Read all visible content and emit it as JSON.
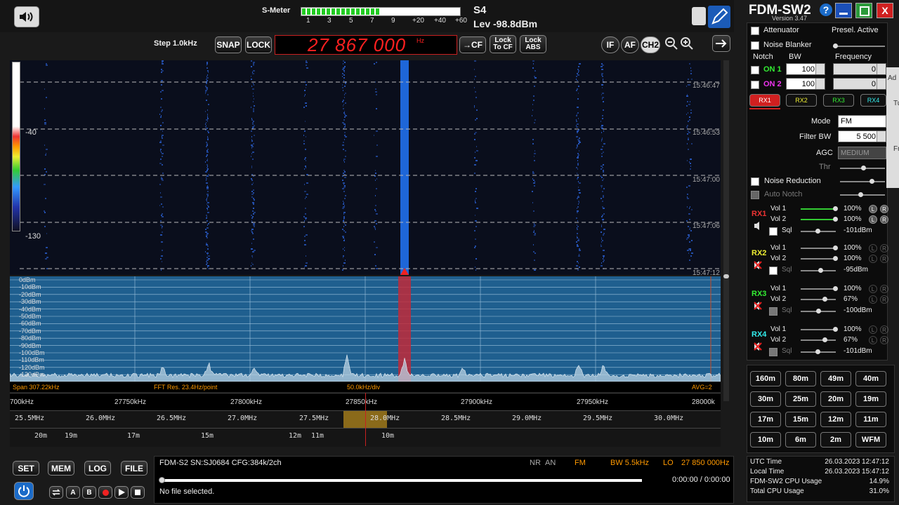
{
  "app": {
    "title": "FDM-SW2",
    "version": "Version 3.47"
  },
  "smeter": {
    "label": "S-Meter",
    "scale": [
      "1",
      "3",
      "5",
      "7",
      "9",
      "+20",
      "+40",
      "+60"
    ],
    "s_value": "S4",
    "level": "Lev -98.8dBm",
    "fill_fraction": 0.5
  },
  "toolbar": {
    "step": "Step 1.0kHz",
    "snap": "SNAP",
    "lock": "LOCK",
    "frequency": "27 867 000",
    "freq_unit": "Hz",
    "cf": "→CF",
    "lock_to_cf": "Lock To CF",
    "lock_abs": "Lock ABS",
    "if": "IF",
    "af": "AF",
    "ch2": "CH2"
  },
  "waterfall": {
    "scale_top": "-40",
    "scale_bottom": "-130",
    "timestamps": [
      "15:46:47",
      "15:46:53",
      "15:47:00",
      "15:47:06",
      "15:47:12"
    ]
  },
  "spectrum": {
    "db_labels": [
      "0dBm",
      "-10dBm",
      "-20dBm",
      "-30dBm",
      "-40dBm",
      "-50dBm",
      "-60dBm",
      "-70dBm",
      "-80dBm",
      "-90dBm",
      "-100dBm",
      "-110dBm",
      "-120dBm",
      "-130dBm"
    ],
    "span": "Span 307.22kHz",
    "fft_res": "FFT Res. 23.4Hz/point",
    "div": "50.0kHz/div",
    "avg": "AVG=2"
  },
  "freq_axis": [
    "700kHz",
    "27750kHz",
    "27800kHz",
    "27850kHz",
    "27900kHz",
    "27950kHz",
    "28000k"
  ],
  "band_axis": [
    "25.5MHz",
    "26.0MHz",
    "26.5MHz",
    "27.0MHz",
    "27.5MHz",
    "28.0MHz",
    "28.5MHz",
    "29.0MHz",
    "29.5MHz",
    "30.0MHz"
  ],
  "meter_axis": [
    "20m",
    "19m",
    "17m",
    "15m",
    "12m",
    "11m",
    "10m"
  ],
  "bottom_buttons": {
    "set": "SET",
    "mem": "MEM",
    "log": "LOG",
    "file": "FILE",
    "a": "A",
    "b": "B"
  },
  "status": {
    "device": "FDM-S2 SN:SJ0684  CFG:384k/2ch",
    "nr": "NR",
    "an": "AN",
    "mode": "FM",
    "bw": "BW 5.5kHz",
    "lo": "LO",
    "lo_freq": "27 850 000Hz",
    "time": "0:00:00 / 0:00:00",
    "file": "No file selected."
  },
  "right_panel": {
    "attenuator": "Attenuator",
    "presel": "Presel. Active",
    "noise_blanker": "Noise Blanker",
    "notch": "Notch",
    "bw": "BW",
    "frequency": "Frequency",
    "on1": "ON 1",
    "on2": "ON 2",
    "bw1": "100",
    "bw2": "100",
    "f1": "0",
    "f2": "0",
    "rx_tabs": [
      "RX1",
      "RX2",
      "RX3",
      "RX4"
    ],
    "mode_label": "Mode",
    "mode": "FM",
    "filter_bw_label": "Filter BW",
    "filter_bw": "5 500",
    "agc_label": "AGC",
    "agc": "MEDIUM",
    "thr": "Thr",
    "noise_reduction": "Noise Reduction",
    "auto_notch": "Auto Notch",
    "vol1": "Vol 1",
    "vol2": "Vol 2",
    "sql": "Sql",
    "l": "L",
    "r": "R",
    "receivers": [
      {
        "name": "RX1",
        "color": "#e33",
        "vol1": "100%",
        "vol2": "100%",
        "sql": "-101dBm",
        "v1f": 1.0,
        "v2f": 1.0,
        "sf": 0.45
      },
      {
        "name": "RX2",
        "color": "#ee3",
        "vol1": "100%",
        "vol2": "100%",
        "sql": "-95dBm",
        "v1f": 1.0,
        "v2f": 1.0,
        "sf": 0.55
      },
      {
        "name": "RX3",
        "color": "#3e3",
        "vol1": "100%",
        "vol2": "67%",
        "sql": "-100dBm",
        "v1f": 1.0,
        "v2f": 0.67,
        "sf": 0.48
      },
      {
        "name": "RX4",
        "color": "#3ee",
        "vol1": "100%",
        "vol2": "67%",
        "sql": "-101dBm",
        "v1f": 1.0,
        "v2f": 0.67,
        "sf": 0.45
      }
    ],
    "bands": [
      "160m",
      "80m",
      "49m",
      "40m",
      "30m",
      "25m",
      "20m",
      "19m",
      "17m",
      "15m",
      "12m",
      "11m",
      "10m",
      "6m",
      "2m",
      "WFM"
    ],
    "info": [
      {
        "k": "UTC Time",
        "v": "26.03.2023 12:47:12"
      },
      {
        "k": "Local Time",
        "v": "26.03.2023 15:47:12"
      },
      {
        "k": "FDM-SW2 CPU Usage",
        "v": "14.9%"
      },
      {
        "k": "Total CPU Usage",
        "v": "31.0%"
      }
    ],
    "cut_labels": [
      "Ad",
      "Tu",
      "Fr"
    ]
  },
  "colors": {
    "accent": "#c82020",
    "spectrum_bg": "#1f5f8f",
    "waterfall_bg": "#0a0e1c",
    "freq_red": "#ff2020"
  }
}
